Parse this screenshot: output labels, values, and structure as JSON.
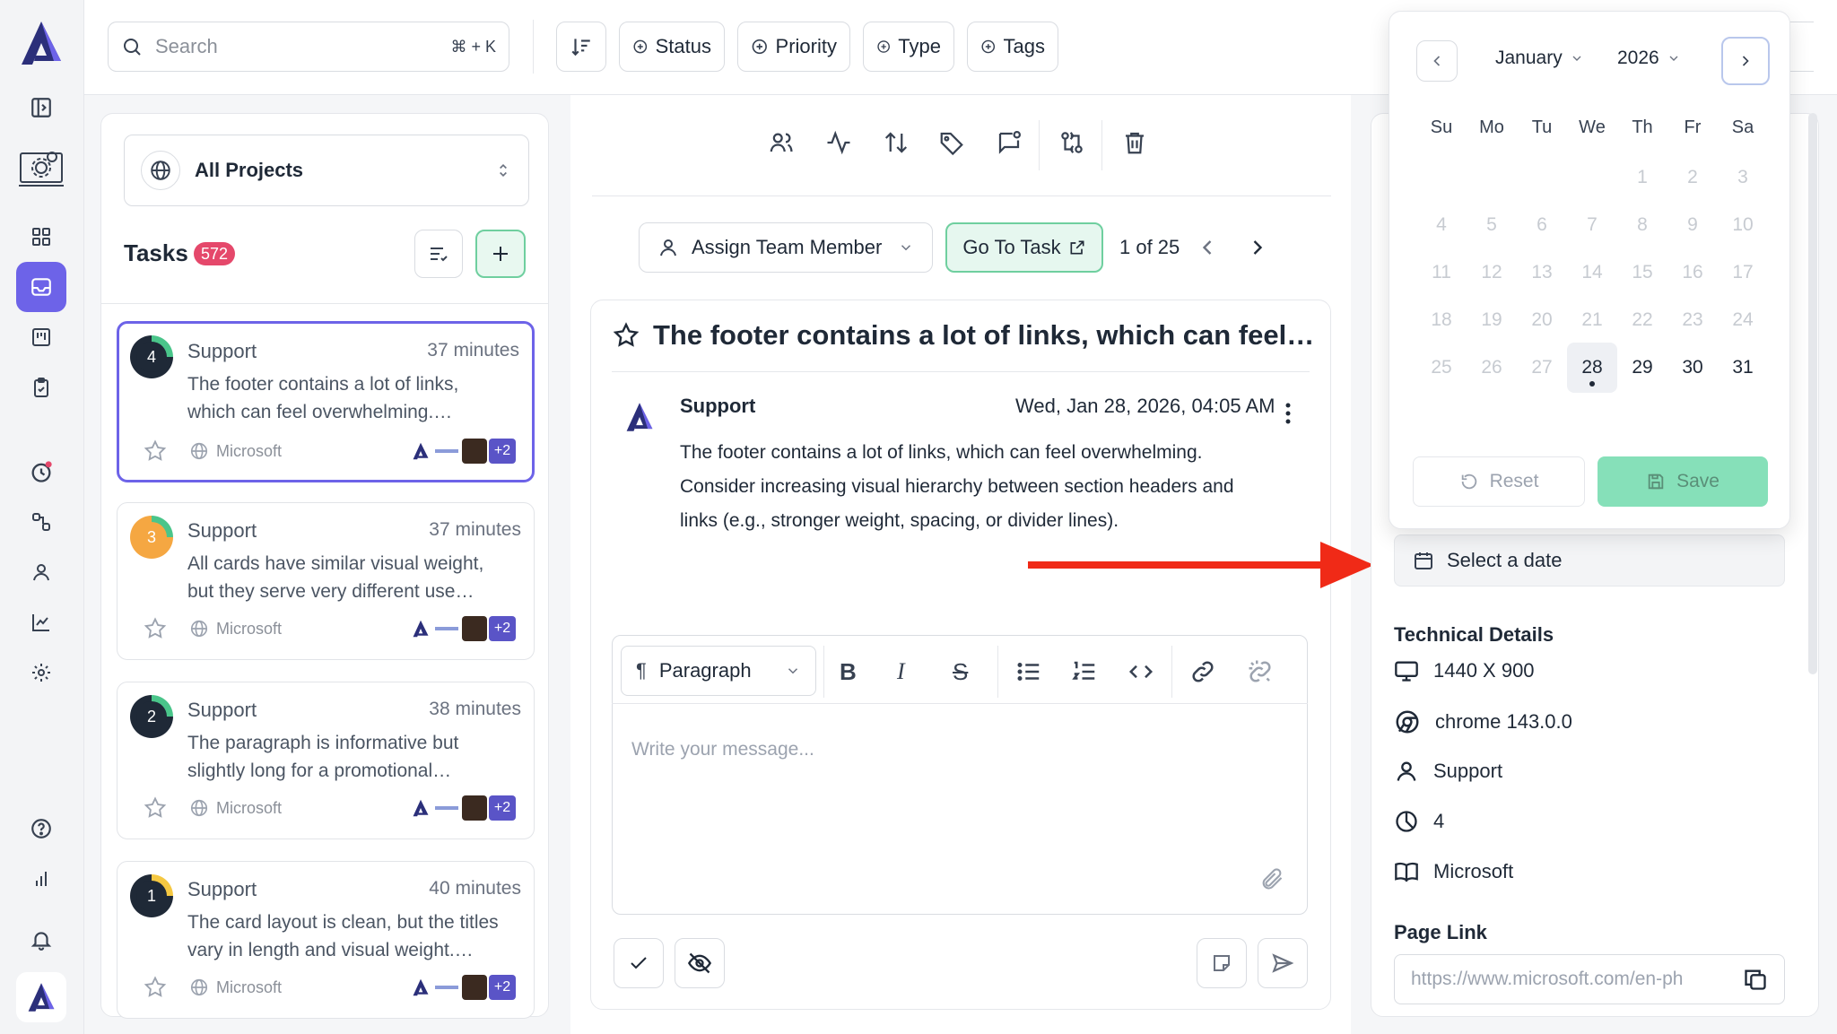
{
  "search": {
    "placeholder": "Search",
    "shortcut": "⌘ + K"
  },
  "filters": [
    {
      "label": "Status"
    },
    {
      "label": "Priority"
    },
    {
      "label": "Type"
    },
    {
      "label": "Tags"
    }
  ],
  "projects": {
    "selected": "All Projects"
  },
  "tasks": {
    "title": "Tasks",
    "count": "572",
    "items": [
      {
        "number": "4",
        "name": "Support",
        "time": "37 minutes",
        "desc": "The footer contains a lot of links, which can feel overwhelming.…",
        "project": "Microsoft",
        "extra": "+2"
      },
      {
        "number": "3",
        "name": "Support",
        "time": "37 minutes",
        "desc": "All cards have similar visual weight, but they serve very different use…",
        "project": "Microsoft",
        "extra": "+2"
      },
      {
        "number": "2",
        "name": "Support",
        "time": "38 minutes",
        "desc": "The paragraph is informative but slightly long for a promotional…",
        "project": "Microsoft",
        "extra": "+2"
      },
      {
        "number": "1",
        "name": "Support",
        "time": "40 minutes",
        "desc": "The card layout is clean, but the titles vary in length and visual weight.…",
        "project": "Microsoft",
        "extra": "+2"
      }
    ]
  },
  "detail": {
    "assign_label": "Assign Team Member",
    "goto_label": "Go To Task",
    "pager": "1 of 25",
    "title": "The footer contains a lot of links, which can feel…",
    "author": "Support",
    "date": "Wed, Jan 28, 2026, 04:05 AM",
    "body_lines": [
      "The footer contains a lot of links, which can feel overwhelming.",
      "Consider increasing visual hierarchy between section headers and",
      "links (e.g., stronger weight, spacing, or divider lines)."
    ],
    "editor_style": "Paragraph",
    "editor_placeholder": "Write your message..."
  },
  "calendar": {
    "month": "January",
    "year": "2026",
    "weekdays": [
      "Su",
      "Mo",
      "Tu",
      "We",
      "Th",
      "Fr",
      "Sa"
    ],
    "days": [
      "1",
      "2",
      "3",
      "4",
      "5",
      "6",
      "7",
      "8",
      "9",
      "10",
      "11",
      "12",
      "13",
      "14",
      "15",
      "16",
      "17",
      "18",
      "19",
      "20",
      "21",
      "22",
      "23",
      "24",
      "25",
      "26",
      "27",
      "28",
      "29",
      "30",
      "31"
    ],
    "first_weekday": 4,
    "selected_day": 28,
    "reset_label": "Reset",
    "save_label": "Save"
  },
  "right_panel": {
    "date_placeholder": "Select a date",
    "tech_title": "Technical Details",
    "resolution": "1440 X 900",
    "browser": "chrome 143.0.0",
    "reporter": "Support",
    "priority": "4",
    "project": "Microsoft",
    "page_link_title": "Page Link",
    "page_link": "https://www.microsoft.com/en-ph"
  },
  "colors": {
    "accent": "#6d63e8",
    "green": "#86e0b9",
    "pink": "#e5486b",
    "arrow": "#f02a17"
  }
}
